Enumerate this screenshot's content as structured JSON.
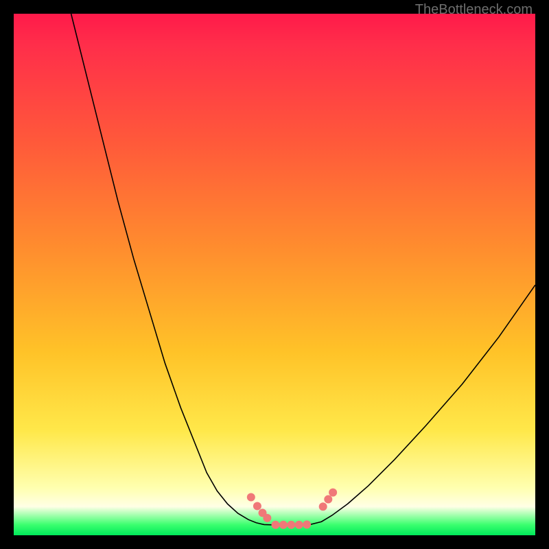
{
  "watermark": "TheBottleneck.com",
  "chart_data": {
    "type": "line",
    "title": "",
    "xlabel": "",
    "ylabel": "",
    "xlim": [
      0,
      100
    ],
    "ylim": [
      0,
      100
    ],
    "series": [
      {
        "name": "left-curve",
        "x": [
          11,
          14,
          17,
          20,
          23,
          26,
          29,
          32,
          35,
          37,
          39,
          41,
          43,
          45,
          46.5,
          48,
          49.5
        ],
        "values": [
          100,
          88,
          76,
          64,
          53,
          43,
          33,
          24.5,
          17,
          12,
          8.5,
          6,
          4.2,
          3,
          2.4,
          2.05,
          2
        ]
      },
      {
        "name": "right-curve",
        "x": [
          55.5,
          57,
          59,
          61,
          64,
          68,
          73,
          79,
          86,
          93,
          100
        ],
        "values": [
          2,
          2.1,
          2.6,
          3.8,
          6,
          9.5,
          14.5,
          21,
          29,
          38,
          48
        ]
      },
      {
        "name": "flat-bottom",
        "x": [
          49.5,
          55.5
        ],
        "values": [
          2,
          2
        ]
      }
    ],
    "markers": [
      {
        "label": "left-marker-1",
        "x": 45.5,
        "y": 7.3
      },
      {
        "label": "left-marker-2",
        "x": 46.7,
        "y": 5.6
      },
      {
        "label": "left-marker-3",
        "x": 47.7,
        "y": 4.3
      },
      {
        "label": "left-marker-4",
        "x": 48.6,
        "y": 3.3
      },
      {
        "label": "bottom-marker-1",
        "x": 50.2,
        "y": 2.0
      },
      {
        "label": "bottom-marker-2",
        "x": 51.7,
        "y": 2.0
      },
      {
        "label": "bottom-marker-3",
        "x": 53.2,
        "y": 2.0
      },
      {
        "label": "bottom-marker-4",
        "x": 54.7,
        "y": 2.0
      },
      {
        "label": "bottom-marker-5",
        "x": 56.2,
        "y": 2.05
      },
      {
        "label": "right-marker-1",
        "x": 59.3,
        "y": 5.5
      },
      {
        "label": "right-marker-2",
        "x": 60.3,
        "y": 6.9
      },
      {
        "label": "right-marker-3",
        "x": 61.2,
        "y": 8.2
      }
    ],
    "colors": {
      "curve_stroke": "#000000",
      "marker_fill": "#f07878",
      "bg_top": "#ff1a4a",
      "bg_mid": "#ffe84a",
      "bg_bottom": "#00e85a",
      "frame": "#000000"
    }
  }
}
